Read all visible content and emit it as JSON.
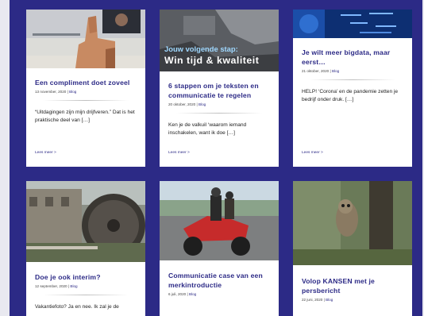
{
  "cards": [
    {
      "title": "Een compliment doet zoveel",
      "date": "13 november, 2020",
      "sep": "|",
      "category": "Blog",
      "excerpt": "“Uitdagingen zijn mijn drijfveren.” Dat is het praktische deel van […]",
      "more": "Lees meer >"
    },
    {
      "title": "6 stappen om je teksten en communicatie te regelen",
      "date": "20 oktober, 2020",
      "sep": "|",
      "category": "Blog",
      "excerpt": "Ken je de valkuil ‘waarom iemand inschakelen, want ik doe […]",
      "more": "Lees meer >",
      "image_line1": "Jouw volgende stap:",
      "image_line2": "Win tijd & kwaliteit"
    },
    {
      "title": "Je wilt meer bigdata, maar eerst…",
      "date": "21 oktober, 2020",
      "sep": "|",
      "category": "Blog",
      "excerpt": "HELP! ‘Corona’ en de pandemie zetten je bedrijf onder druk. […]",
      "more": "Lees meer >"
    },
    {
      "title": "Doe je ook interim?",
      "date": "12 september, 2020",
      "sep": "|",
      "category": "Blog",
      "excerpt": "Vakantiefoto? Ja en nee. Ik zal je de"
    },
    {
      "title": "Communicatie case van een merkintroductie",
      "date": "6 juli, 2020",
      "sep": "|",
      "category": "Blog"
    },
    {
      "title": "Volop KANSEN met je persbericht",
      "date": "22 juni, 2020",
      "sep": "|",
      "category": "Blog"
    }
  ],
  "colors": {
    "brand": "#2c2a86",
    "card": "#ffffff",
    "page": "#e9e9f0"
  }
}
